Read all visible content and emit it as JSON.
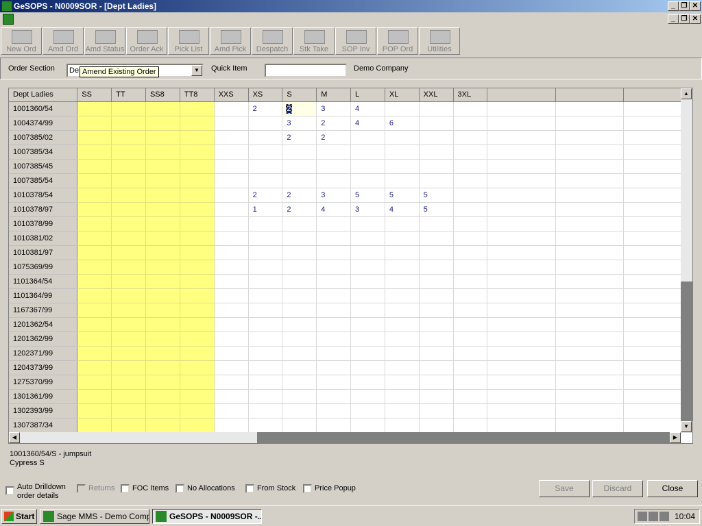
{
  "window": {
    "title": "GeSOPS - N0009SOR - [Dept Ladies]"
  },
  "toolbar": {
    "buttons": [
      {
        "label": "New Ord",
        "icon": "new-order-icon"
      },
      {
        "label": "Amd Ord",
        "icon": "amend-order-icon"
      },
      {
        "label": "Amd Status",
        "icon": "amend-status-icon"
      },
      {
        "label": "Order Ack",
        "icon": "order-ack-icon"
      },
      {
        "label": "Pick List",
        "icon": "pick-list-icon"
      },
      {
        "label": "Amd Pick",
        "icon": "amend-pick-icon"
      },
      {
        "label": "Despatch",
        "icon": "despatch-icon"
      },
      {
        "label": "Stk Take",
        "icon": "stock-take-icon"
      },
      {
        "label": "SOP Inv",
        "icon": "sop-invoice-icon"
      },
      {
        "label": "POP Ord",
        "icon": "pop-order-icon"
      },
      {
        "label": "Utilities",
        "icon": "utilities-icon"
      }
    ]
  },
  "order_section": {
    "label": "Order Section",
    "value": "De",
    "tooltip": "Amend Existing Order",
    "quick_item_label": "Quick Item",
    "quick_item_value": "",
    "company": "Demo Company"
  },
  "grid": {
    "headers": [
      "Dept Ladies",
      "SS",
      "TT",
      "SS8",
      "TT8",
      "XXS",
      "XS",
      "S",
      "M",
      "L",
      "XL",
      "XXL",
      "3XL",
      "",
      "",
      ""
    ],
    "rows": [
      {
        "id": "1001360/54",
        "cells": [
          "",
          "",
          "",
          "",
          "",
          "2",
          "2",
          "3",
          "4",
          "",
          "",
          "",
          "",
          "",
          ""
        ]
      },
      {
        "id": "1004374/99",
        "cells": [
          "",
          "",
          "",
          "",
          "",
          "",
          "3",
          "2",
          "4",
          "6",
          "",
          "",
          "",
          "",
          ""
        ]
      },
      {
        "id": "1007385/02",
        "cells": [
          "",
          "",
          "",
          "",
          "",
          "",
          "2",
          "2",
          "",
          "",
          "",
          "",
          "",
          "",
          ""
        ]
      },
      {
        "id": "1007385/34",
        "cells": [
          "",
          "",
          "",
          "",
          "",
          "",
          "",
          "",
          "",
          "",
          "",
          "",
          "",
          "",
          ""
        ]
      },
      {
        "id": "1007385/45",
        "cells": [
          "",
          "",
          "",
          "",
          "",
          "",
          "",
          "",
          "",
          "",
          "",
          "",
          "",
          "",
          ""
        ]
      },
      {
        "id": "1007385/54",
        "cells": [
          "",
          "",
          "",
          "",
          "",
          "",
          "",
          "",
          "",
          "",
          "",
          "",
          "",
          "",
          ""
        ]
      },
      {
        "id": "1010378/54",
        "cells": [
          "",
          "",
          "",
          "",
          "",
          "2",
          "2",
          "3",
          "5",
          "5",
          "5",
          "",
          "",
          "",
          ""
        ]
      },
      {
        "id": "1010378/97",
        "cells": [
          "",
          "",
          "",
          "",
          "",
          "1",
          "2",
          "4",
          "3",
          "4",
          "5",
          "",
          "",
          "",
          ""
        ]
      },
      {
        "id": "1010378/99",
        "cells": [
          "",
          "",
          "",
          "",
          "",
          "",
          "",
          "",
          "",
          "",
          "",
          "",
          "",
          "",
          ""
        ]
      },
      {
        "id": "1010381/02",
        "cells": [
          "",
          "",
          "",
          "",
          "",
          "",
          "",
          "",
          "",
          "",
          "",
          "",
          "",
          "",
          ""
        ]
      },
      {
        "id": "1010381/97",
        "cells": [
          "",
          "",
          "",
          "",
          "",
          "",
          "",
          "",
          "",
          "",
          "",
          "",
          "",
          "",
          ""
        ]
      },
      {
        "id": "1075369/99",
        "cells": [
          "",
          "",
          "",
          "",
          "",
          "",
          "",
          "",
          "",
          "",
          "",
          "",
          "",
          "",
          ""
        ]
      },
      {
        "id": "1101364/54",
        "cells": [
          "",
          "",
          "",
          "",
          "",
          "",
          "",
          "",
          "",
          "",
          "",
          "",
          "",
          "",
          ""
        ]
      },
      {
        "id": "1101364/99",
        "cells": [
          "",
          "",
          "",
          "",
          "",
          "",
          "",
          "",
          "",
          "",
          "",
          "",
          "",
          "",
          ""
        ]
      },
      {
        "id": "1167367/99",
        "cells": [
          "",
          "",
          "",
          "",
          "",
          "",
          "",
          "",
          "",
          "",
          "",
          "",
          "",
          "",
          ""
        ]
      },
      {
        "id": "1201362/54",
        "cells": [
          "",
          "",
          "",
          "",
          "",
          "",
          "",
          "",
          "",
          "",
          "",
          "",
          "",
          "",
          ""
        ]
      },
      {
        "id": "1201362/99",
        "cells": [
          "",
          "",
          "",
          "",
          "",
          "",
          "",
          "",
          "",
          "",
          "",
          "",
          "",
          "",
          ""
        ]
      },
      {
        "id": "1202371/99",
        "cells": [
          "",
          "",
          "",
          "",
          "",
          "",
          "",
          "",
          "",
          "",
          "",
          "",
          "",
          "",
          ""
        ]
      },
      {
        "id": "1204373/99",
        "cells": [
          "",
          "",
          "",
          "",
          "",
          "",
          "",
          "",
          "",
          "",
          "",
          "",
          "",
          "",
          ""
        ]
      },
      {
        "id": "1275370/99",
        "cells": [
          "",
          "",
          "",
          "",
          "",
          "",
          "",
          "",
          "",
          "",
          "",
          "",
          "",
          "",
          ""
        ]
      },
      {
        "id": "1301361/99",
        "cells": [
          "",
          "",
          "",
          "",
          "",
          "",
          "",
          "",
          "",
          "",
          "",
          "",
          "",
          "",
          ""
        ]
      },
      {
        "id": "1302393/99",
        "cells": [
          "",
          "",
          "",
          "",
          "",
          "",
          "",
          "",
          "",
          "",
          "",
          "",
          "",
          "",
          ""
        ]
      },
      {
        "id": "1307387/34",
        "cells": [
          "",
          "",
          "",
          "",
          "",
          "",
          "",
          "",
          "",
          "",
          "",
          "",
          "",
          "",
          ""
        ]
      }
    ],
    "selected": {
      "row": 0,
      "col": 6
    }
  },
  "item_info": {
    "line1": "1001360/54/S - jumpsuit",
    "line2": "Cypress S"
  },
  "options": {
    "auto_drilldown": "Auto Drilldown",
    "auto_drilldown_2": "order details",
    "returns": "Returns",
    "foc_items": "FOC Items",
    "no_allocations": "No Allocations",
    "from_stock": "From Stock",
    "price_popup": "Price Popup"
  },
  "actions": {
    "save": "Save",
    "discard": "Discard",
    "close": "Close"
  },
  "taskbar": {
    "start": "Start",
    "tasks": [
      {
        "label": "Sage MMS - Demo Comp..."
      },
      {
        "label": "GeSOPS - N0009SOR -..."
      }
    ],
    "clock": "10:04"
  },
  "colors": {
    "title_start": "#0a246a",
    "title_end": "#a6caf0",
    "yellow_col": "#ffff80",
    "grid_value": "#1a1a80"
  }
}
